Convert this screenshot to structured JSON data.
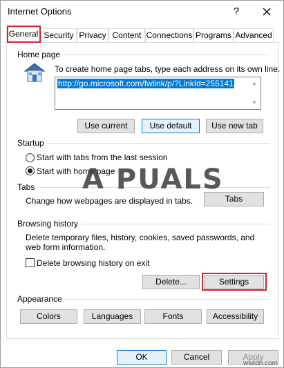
{
  "window": {
    "title": "Internet Options",
    "help": "?",
    "close": "✕"
  },
  "tabs": [
    {
      "label": "General"
    },
    {
      "label": "Security"
    },
    {
      "label": "Privacy"
    },
    {
      "label": "Content"
    },
    {
      "label": "Connections"
    },
    {
      "label": "Programs"
    },
    {
      "label": "Advanced"
    }
  ],
  "home_page": {
    "group_label": "Home page",
    "description": "To create home page tabs, type each address on its own line.",
    "url": "http://go.microsoft.com/fwlink/p/?LinkId=255141",
    "buttons": {
      "use_current": "Use current",
      "use_default": "Use default",
      "use_new_tab": "Use new tab"
    }
  },
  "startup": {
    "group_label": "Startup",
    "option_last_session": "Start with tabs from the last session",
    "option_home_page": "Start with home page",
    "selected": "home_page"
  },
  "tabs_section": {
    "group_label": "Tabs",
    "description": "Change how webpages are displayed in tabs.",
    "button": "Tabs"
  },
  "browsing_history": {
    "group_label": "Browsing history",
    "description": "Delete temporary files, history, cookies, saved passwords, and web form information.",
    "checkbox_label": "Delete browsing history on exit",
    "checkbox_checked": false,
    "delete_button": "Delete...",
    "settings_button": "Settings"
  },
  "appearance": {
    "group_label": "Appearance",
    "buttons": {
      "colors": "Colors",
      "languages": "Languages",
      "fonts": "Fonts",
      "accessibility": "Accessibility"
    }
  },
  "footer": {
    "ok": "OK",
    "cancel": "Cancel",
    "apply": "Apply"
  },
  "watermark": {
    "text": "A  PUALS",
    "corner": "wsxdn.com"
  },
  "colors": {
    "highlight_red": "#d6222e",
    "selection_blue": "#0078d7"
  }
}
